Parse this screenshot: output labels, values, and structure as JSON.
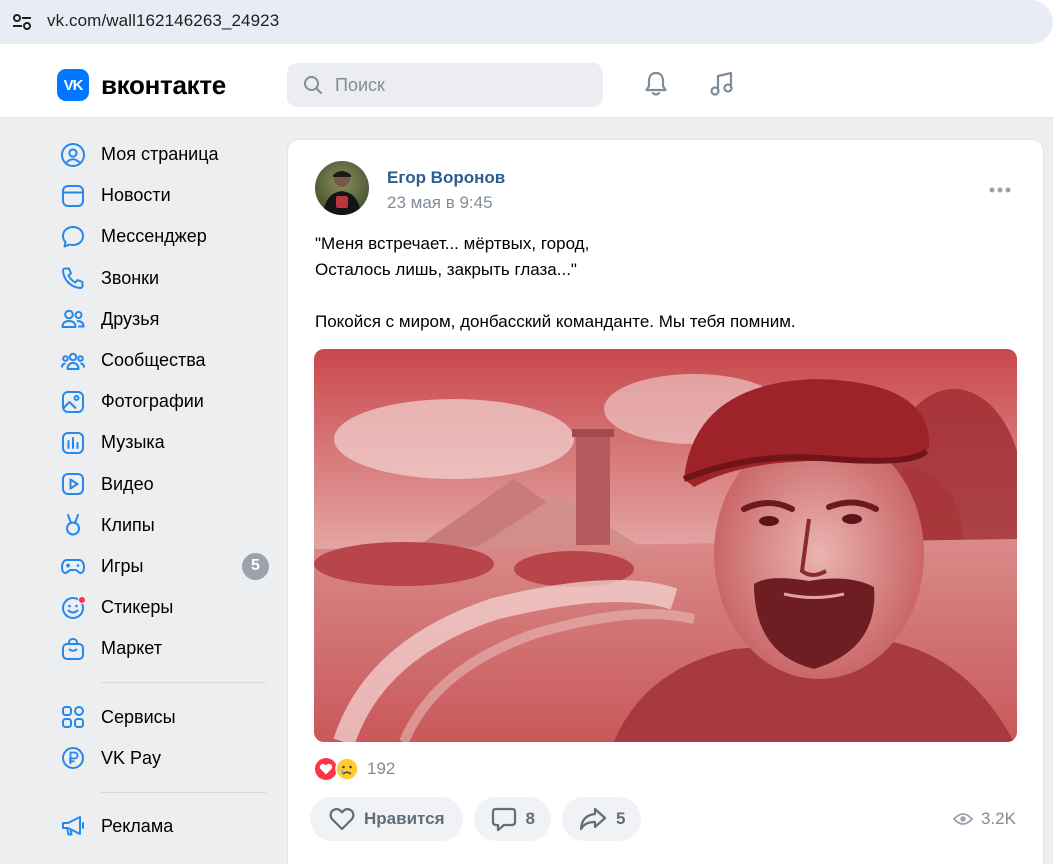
{
  "browser": {
    "url": "vk.com/wall162146263_24923",
    "icon": "tune-icon"
  },
  "header": {
    "logo_text": "вконтакте",
    "logo_mark": "VK",
    "search_placeholder": "Поиск",
    "icons": [
      "bell-icon",
      "music-icon"
    ],
    "accent_color": "#0077ff"
  },
  "sidebar": {
    "items": [
      {
        "label": "Моя страница",
        "icon": "user-circle-icon"
      },
      {
        "label": "Новости",
        "icon": "news-icon"
      },
      {
        "label": "Мессенджер",
        "icon": "chat-bubble-icon"
      },
      {
        "label": "Звонки",
        "icon": "phone-icon"
      },
      {
        "label": "Друзья",
        "icon": "friends-icon"
      },
      {
        "label": "Сообщества",
        "icon": "communities-icon"
      },
      {
        "label": "Фотографии",
        "icon": "photo-icon"
      },
      {
        "label": "Музыка",
        "icon": "music-chart-icon"
      },
      {
        "label": "Видео",
        "icon": "video-play-icon"
      },
      {
        "label": "Клипы",
        "icon": "clips-icon"
      },
      {
        "label": "Игры",
        "icon": "gamepad-icon",
        "badge": "5"
      },
      {
        "label": "Стикеры",
        "icon": "smiley-icon",
        "dot": true
      },
      {
        "label": "Маркет",
        "icon": "shopping-bag-icon"
      }
    ],
    "secondary": [
      {
        "label": "Сервисы",
        "icon": "services-grid-icon"
      },
      {
        "label": "VK Pay",
        "icon": "ruble-icon"
      }
    ],
    "tertiary": [
      {
        "label": "Реклама",
        "icon": "megaphone-icon"
      }
    ]
  },
  "post": {
    "author": "Егор Воронов",
    "date": "23 мая в 9:45",
    "text": "\"Меня встречает... мёртвых, город,\nОсталось лишь, закрыть глаза...\"\n\nПокойся с миром, донбасский команданте. Мы тебя помним.",
    "reactions": {
      "icons": [
        "heart-reaction-icon",
        "crying-reaction-icon"
      ],
      "count": "192"
    },
    "actions": {
      "like_label": "Нравится",
      "comments_count": "8",
      "shares_count": "5"
    },
    "views": "3.2K",
    "image_tint": "#c0383c"
  }
}
